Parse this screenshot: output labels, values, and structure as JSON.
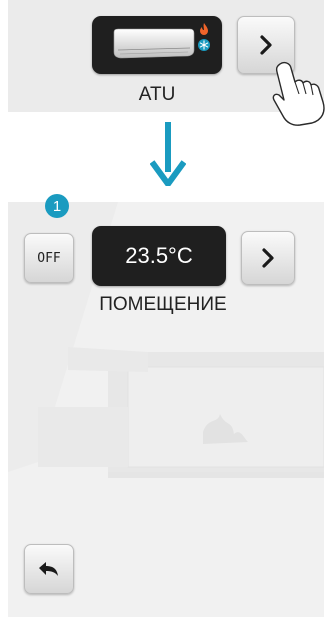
{
  "top": {
    "device_label": "ATU",
    "device_icon": "air-conditioner-icon",
    "mode_icons": [
      "flame-icon",
      "snowflake-icon"
    ],
    "next_icon": "chevron-right-icon"
  },
  "flow_icon": "arrow-down-icon",
  "bottom": {
    "step_badge": "1",
    "off_label": "OFF",
    "temperature": "23.5°C",
    "zone_label": "ПОМЕЩЕНИЕ",
    "next_icon": "chevron-right-icon",
    "back_icon": "back-arrow-icon"
  },
  "colors": {
    "accent": "#1a9bc0",
    "tile_dark": "#1f1f1f",
    "panel_bg": "#ebebeb"
  }
}
